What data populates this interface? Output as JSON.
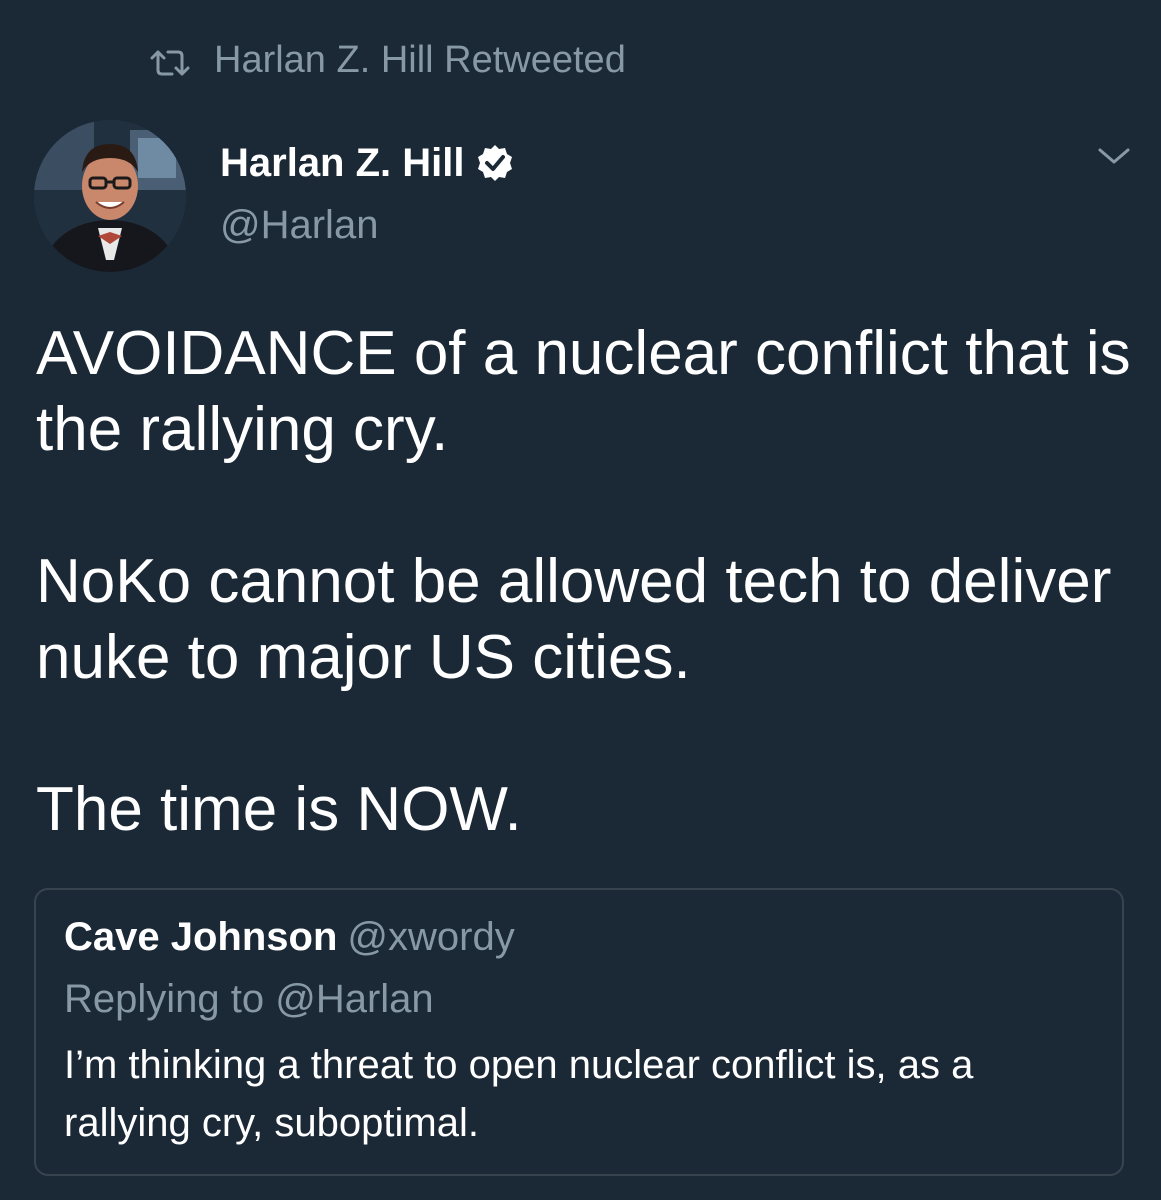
{
  "retweet": {
    "icon": "retweet-icon",
    "label": "Harlan Z. Hill Retweeted"
  },
  "author": {
    "display_name": "Harlan Z. Hill",
    "handle": "@Harlan",
    "verified_icon": "verified-badge-icon",
    "avatar_icon": "avatar"
  },
  "menu": {
    "icon": "chevron-down-icon"
  },
  "tweet": {
    "paragraphs": [
      "AVOIDANCE of a nuclear conflict that is the rallying cry.",
      "NoKo cannot be allowed tech to deliver nuke to major US cities.",
      "The time is NOW."
    ]
  },
  "quote": {
    "display_name": "Cave Johnson",
    "handle": "@xwordy",
    "replying_to": "Replying to @Harlan",
    "text": "I’m thinking a threat to open nuclear conflict is, as a rallying cry, suboptimal."
  },
  "colors": {
    "background": "#1b2836",
    "text": "#ffffff",
    "muted": "#8899a6",
    "border": "#38444d"
  }
}
